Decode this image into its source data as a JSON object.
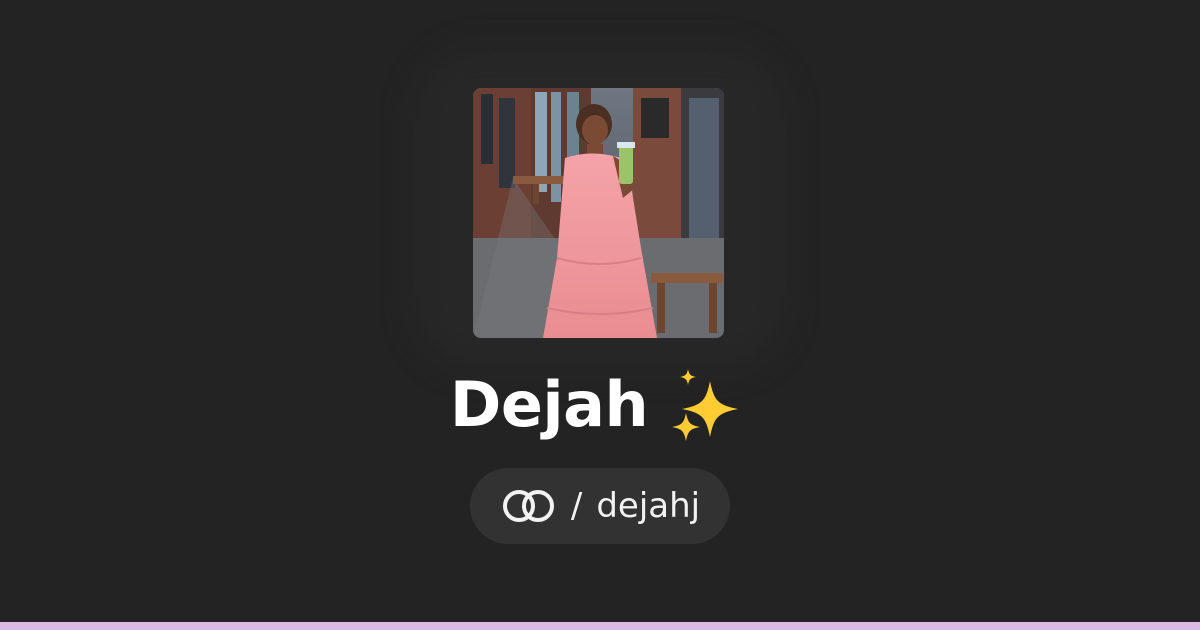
{
  "profile": {
    "display_name": "Dejah",
    "emoji_icon": "sparkles-icon",
    "service_logo_icon": "linked-rings-logo-icon",
    "separator": "/",
    "username": "dejahj",
    "avatar_icon": "profile-photo"
  },
  "colors": {
    "background": "#232323",
    "pill_background": "#323232",
    "text_primary": "#ffffff",
    "accent_bar": "#dcb9e7",
    "sparkle": "#ffcc33"
  }
}
